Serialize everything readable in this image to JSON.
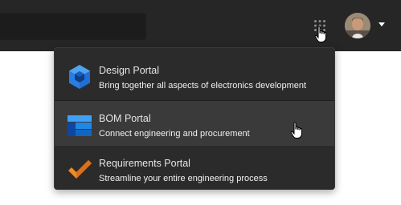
{
  "header": {
    "apps_icon": "grid-dots-icon",
    "avatar": "user-avatar",
    "avatar_menu_icon": "caret-down-icon"
  },
  "portal_menu": {
    "items": [
      {
        "title": "Design Portal",
        "subtitle": "Bring together all aspects of electronics development",
        "icon": "design-portal-logo-icon",
        "hovered": false
      },
      {
        "title": "BOM Portal",
        "subtitle": "Connect engineering and procurement",
        "icon": "bom-portal-logo-icon",
        "hovered": true
      },
      {
        "title": "Requirements Portal",
        "subtitle": "Streamline your entire engineering process",
        "icon": "requirements-portal-logo-icon",
        "hovered": false
      }
    ]
  },
  "colors": {
    "topbar": "#262626",
    "menu_background": "#2b2b2b",
    "menu_hover": "#3a3a3a",
    "design_blue": "#2a7de1",
    "bom_blue": "#1e88e5",
    "requirements_orange": "#f08a24"
  }
}
